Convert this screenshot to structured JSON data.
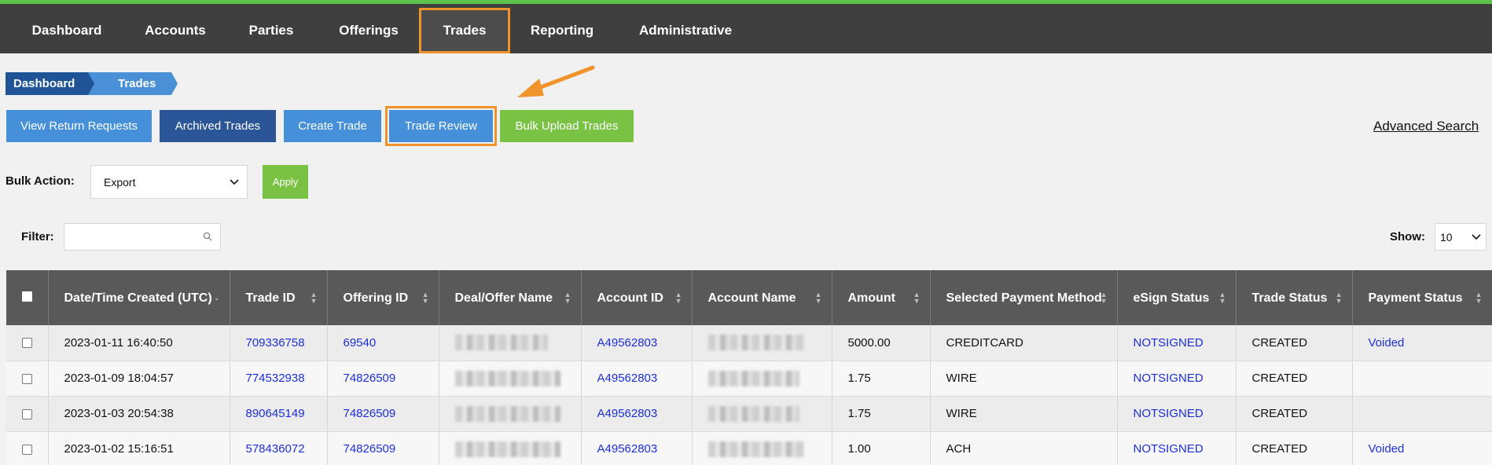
{
  "nav": {
    "items": [
      {
        "label": "Dashboard"
      },
      {
        "label": "Accounts"
      },
      {
        "label": "Parties"
      },
      {
        "label": "Offerings"
      },
      {
        "label": "Trades"
      },
      {
        "label": "Reporting"
      },
      {
        "label": "Administrative"
      }
    ],
    "active": "Trades"
  },
  "breadcrumb": [
    "Dashboard",
    "Trades"
  ],
  "actions": {
    "view_return_requests": "View Return Requests",
    "archived_trades": "Archived Trades",
    "create_trade": "Create Trade",
    "trade_review": "Trade Review",
    "bulk_upload_trades": "Bulk Upload Trades",
    "advanced_search": "Advanced Search"
  },
  "bulk_action": {
    "label": "Bulk Action:",
    "selected": "Export",
    "apply": "Apply"
  },
  "filter": {
    "label": "Filter:",
    "value": ""
  },
  "show": {
    "label": "Show:",
    "selected": "10"
  },
  "table": {
    "headers": [
      "Date/Time Created (UTC)",
      "Trade ID",
      "Offering ID",
      "Deal/Offer Name",
      "Account ID",
      "Account Name",
      "Amount",
      "Selected Payment Method",
      "eSign Status",
      "Trade Status",
      "Payment Status"
    ],
    "rows": [
      {
        "date": "2023-01-11 16:40:50",
        "trade_id": "709336758",
        "offering_id": "69540",
        "account_id": "A49562803",
        "amount": "5000.00",
        "payment_method": "CREDITCARD",
        "esign": "NOTSIGNED",
        "trade_status": "CREATED",
        "payment_status": "Voided"
      },
      {
        "date": "2023-01-09 18:04:57",
        "trade_id": "774532938",
        "offering_id": "74826509",
        "account_id": "A49562803",
        "amount": "1.75",
        "payment_method": "WIRE",
        "esign": "NOTSIGNED",
        "trade_status": "CREATED",
        "payment_status": ""
      },
      {
        "date": "2023-01-03 20:54:38",
        "trade_id": "890645149",
        "offering_id": "74826509",
        "account_id": "A49562803",
        "amount": "1.75",
        "payment_method": "WIRE",
        "esign": "NOTSIGNED",
        "trade_status": "CREATED",
        "payment_status": ""
      },
      {
        "date": "2023-01-02 15:16:51",
        "trade_id": "578436072",
        "offering_id": "74826509",
        "account_id": "A49562803",
        "amount": "1.00",
        "payment_method": "ACH",
        "esign": "NOTSIGNED",
        "trade_status": "CREATED",
        "payment_status": "Voided"
      }
    ]
  },
  "colors": {
    "nav_bg": "#3f3f3f",
    "accent_green": "#79c244",
    "button_blue": "#4590d9",
    "button_dark_blue": "#2a5597",
    "highlight_orange": "#f0932b",
    "link_blue": "#1c2fd6"
  }
}
